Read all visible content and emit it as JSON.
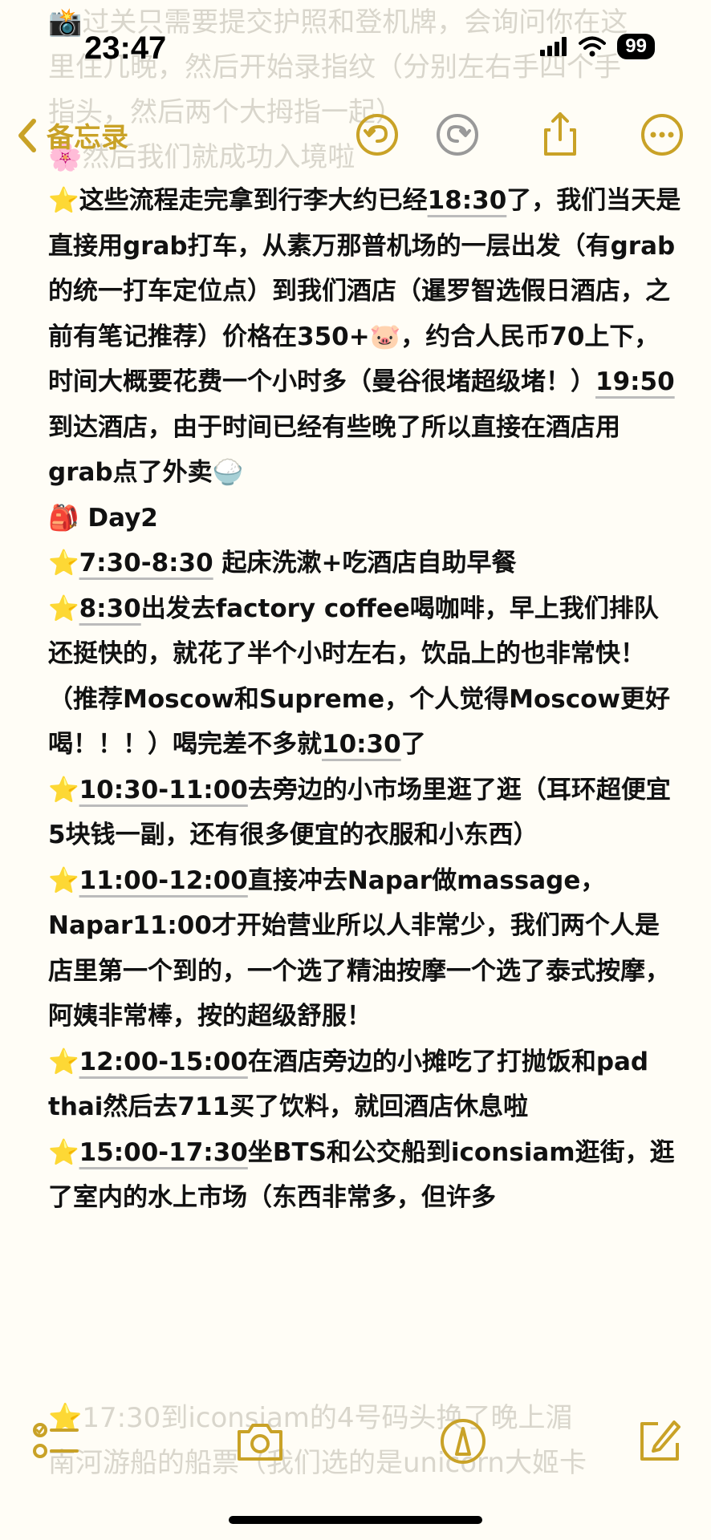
{
  "status_bar": {
    "time": "23:47",
    "battery": "99"
  },
  "nav": {
    "back_label": "备忘录"
  },
  "background_faded_top": [
    "📸过关只需要提交护照和登机牌，会询问你在这",
    "里住几晚，然后开始录指纹（分别左右手四个手",
    "指头，然后两个大拇指一起）",
    "🌸然后我们就成功入境啦"
  ],
  "background_faded_bottom": [
    "⭐17:30到iconsiam的4号码头换了晚上湄",
    "南河游船的船票（我们选的是unicorn大姬卡"
  ],
  "note": [
    {
      "icon": "⭐",
      "time": "",
      "pre": "这些流程走完拿到行李大约已经",
      "time_mid": "18:30",
      "text": "了，我们当天是直接用grab打车，从素万那普机场的一层出发（有grab的统一打车定位点）到我们酒店（暹罗智选假日酒店，之前有笔记推荐）价格在350+🐷，约合人民币70上下，时间大概要花费一个小时多（曼谷很堵超级堵！）",
      "time2": "19:50",
      "text2": "到达酒店，由于时间已经有些晚了所以直接在酒店用grab点了外卖🍚"
    },
    {
      "icon": "🎒",
      "time": "",
      "pre": "Day2",
      "time_mid": "",
      "text": "",
      "time2": "",
      "text2": ""
    },
    {
      "icon": "⭐",
      "time": "7:30-8:30",
      "pre": "",
      "time_mid": "",
      "text": " 起床洗漱+吃酒店自助早餐",
      "time2": "",
      "text2": ""
    },
    {
      "icon": "⭐",
      "time": "8:30",
      "pre": "",
      "time_mid": "",
      "text": "出发去factory coffee喝咖啡，早上我们排队还挺快的，就花了半个小时左右，饮品上的也非常快！（推荐Moscow和Supreme，个人觉得Moscow更好喝！！！）喝完差不多就",
      "time2": "10:30",
      "text2": "了"
    },
    {
      "icon": "⭐",
      "time": "10:30-11:00",
      "pre": "",
      "time_mid": "",
      "text": "去旁边的小市场里逛了逛（耳环超便宜5块钱一副，还有很多便宜的衣服和小东西）",
      "time2": "",
      "text2": ""
    },
    {
      "icon": "⭐",
      "time": "11:00-12:00",
      "pre": "",
      "time_mid": "",
      "text": "直接冲去Napar做massage，Napar11:00才开始营业所以人非常少，我们两个人是店里第一个到的，一个选了精油按摩一个选了泰式按摩，阿姨非常棒，按的超级舒服！",
      "time2": "",
      "text2": ""
    },
    {
      "icon": "⭐",
      "time": "12:00-15:00",
      "pre": "",
      "time_mid": "",
      "text": "在酒店旁边的小摊吃了打抛饭和pad thai然后去711买了饮料，就回酒店休息啦",
      "time2": "",
      "text2": ""
    },
    {
      "icon": "⭐",
      "time": "15:00-17:30",
      "pre": "",
      "time_mid": "",
      "text": "坐BTS和公交船到iconsiam逛街，逛了室内的水上市场（东西非常多，但许多",
      "time2": "",
      "text2": ""
    }
  ],
  "colors": {
    "accent": "#c9a227",
    "background": "#fffdf6",
    "text": "#111111"
  },
  "icons": [
    "chevron-left-icon",
    "undo-icon",
    "redo-icon",
    "share-icon",
    "more-icon",
    "checklist-icon",
    "camera-icon",
    "markup-icon",
    "compose-icon"
  ]
}
